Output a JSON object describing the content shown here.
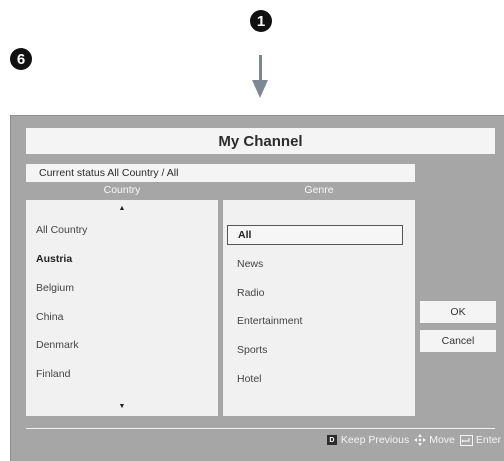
{
  "callouts": {
    "step_1": "1",
    "step_6": "6"
  },
  "dialog": {
    "title": "My Channel",
    "current_status": "Current status All Country / All",
    "country_header": "Country",
    "genre_header": "Genre",
    "countries": [
      "All Country",
      "Austria",
      "Belgium",
      "China",
      "Denmark",
      "Finland"
    ],
    "genres": [
      "All",
      "News",
      "Radio",
      "Entertainment",
      "Sports",
      "Hotel"
    ],
    "ok_label": "OK",
    "cancel_label": "Cancel"
  },
  "footer": {
    "keep_previous_key": "D",
    "keep_previous_label": "Keep Previous",
    "move_label": "Move",
    "enter_label": "Enter"
  },
  "colors": {
    "panel_bg": "#a6a6a6",
    "list_bg": "#f1f1f1",
    "arrow": "#7e8792"
  }
}
